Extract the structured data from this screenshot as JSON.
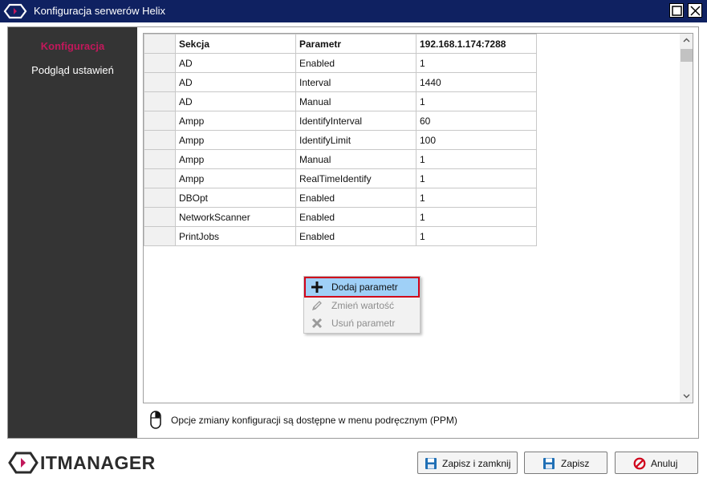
{
  "window": {
    "title": "Konfiguracja serwerów Helix"
  },
  "sidebar": {
    "items": [
      {
        "label": "Konfiguracja",
        "active": true
      },
      {
        "label": "Podgląd ustawień",
        "active": false
      }
    ]
  },
  "grid": {
    "columns": [
      "Sekcja",
      "Parametr",
      "192.168.1.174:7288"
    ],
    "rows": [
      [
        "AD",
        "Enabled",
        "1"
      ],
      [
        "AD",
        "Interval",
        "1440"
      ],
      [
        "AD",
        "Manual",
        "1"
      ],
      [
        "Ampp",
        "IdentifyInterval",
        "60"
      ],
      [
        "Ampp",
        "IdentifyLimit",
        "100"
      ],
      [
        "Ampp",
        "Manual",
        "1"
      ],
      [
        "Ampp",
        "RealTimeIdentify",
        "1"
      ],
      [
        "DBOpt",
        "Enabled",
        "1"
      ],
      [
        "NetworkScanner",
        "Enabled",
        "1"
      ],
      [
        "PrintJobs",
        "Enabled",
        "1"
      ]
    ]
  },
  "context_menu": {
    "items": [
      {
        "label": "Dodaj parametr",
        "icon": "plus-icon",
        "enabled": true
      },
      {
        "label": "Zmień wartość",
        "icon": "pencil-icon",
        "enabled": false
      },
      {
        "label": "Usuń parametr",
        "icon": "x-icon",
        "enabled": false
      }
    ]
  },
  "hint": {
    "text": "Opcje zmiany konfiguracji są dostępne w menu podręcznym (PPM)",
    "icon": "mouse-icon"
  },
  "footer": {
    "logo_text_it": "IT",
    "logo_text_rest": "MANAGER",
    "buttons": {
      "save_close": "Zapisz i zamknij",
      "save": "Zapisz",
      "cancel": "Anuluj"
    }
  },
  "colors": {
    "titlebar": "#0f2161",
    "sidebar": "#343434",
    "accent": "#c2185b",
    "menu_highlight": "#9fd0f7",
    "menu_outline": "#d0021b"
  }
}
